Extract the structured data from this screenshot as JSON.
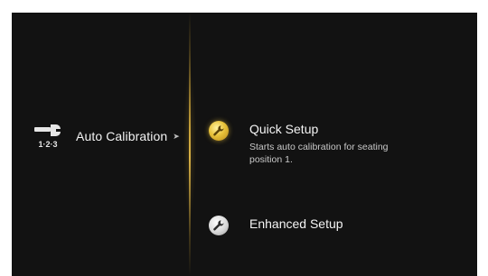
{
  "category": {
    "icon": "wrench-123-icon",
    "number_label": "1·2·3",
    "label": "Auto Calibration",
    "arrow": "➤"
  },
  "menu": {
    "items": [
      {
        "icon": "wrench-icon",
        "title": "Quick Setup",
        "description": "Starts auto calibration for seating position 1.",
        "selected": true
      },
      {
        "icon": "wrench-icon",
        "title": "Enhanced Setup",
        "selected": false
      }
    ]
  },
  "colors": {
    "background": "#121212",
    "accent": "#d8b045",
    "text": "#f2f2f2"
  }
}
